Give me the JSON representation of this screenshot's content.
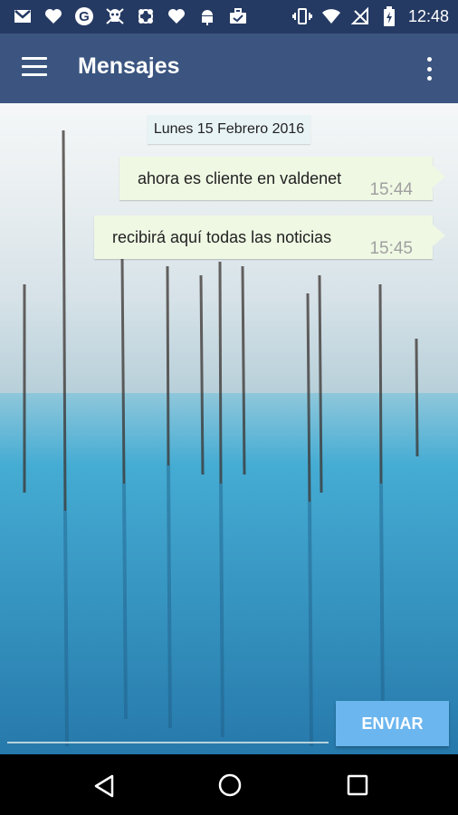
{
  "status_bar": {
    "time": "12:48",
    "left_icons": [
      "gmail-icon",
      "heart-icon",
      "google-icon",
      "skull-icon",
      "candy-icon",
      "heart-icon",
      "android-icon",
      "briefcase-icon"
    ],
    "right_icons": [
      "vibrate-icon",
      "wifi-icon",
      "no-signal-icon",
      "battery-charging-icon"
    ]
  },
  "app_bar": {
    "title": "Mensajes",
    "background": "#3b5580"
  },
  "chat": {
    "date_label": "Lunes 15 Febrero 2016",
    "messages": [
      {
        "text": "ahora es cliente en valdenet",
        "time": "15:44"
      },
      {
        "text": "recibirá aquí todas las noticias",
        "time": "15:45"
      }
    ]
  },
  "composer": {
    "input_value": "",
    "send_label": "ENVIAR",
    "send_color": "#6cb6ef"
  },
  "nav_bar": {
    "buttons": [
      "back-icon",
      "home-icon",
      "recents-icon"
    ]
  }
}
